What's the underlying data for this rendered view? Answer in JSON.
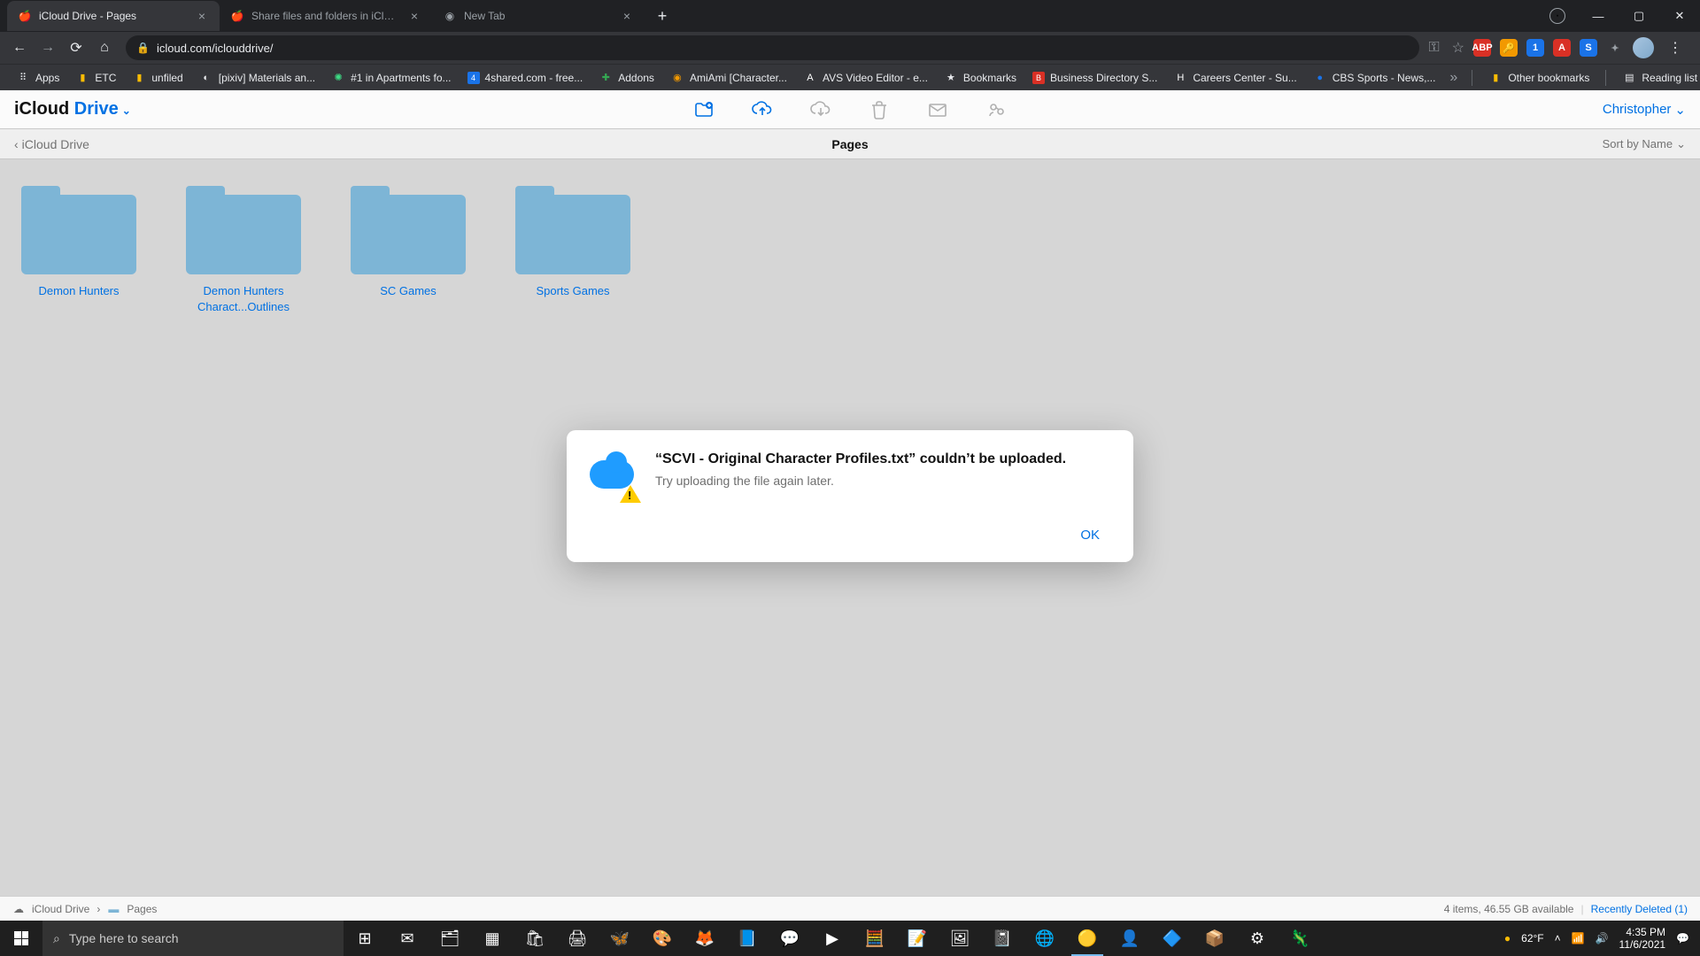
{
  "browser": {
    "tabs": [
      {
        "title": "iCloud Drive - Pages",
        "active": true
      },
      {
        "title": "Share files and folders in iCloud D",
        "active": false
      },
      {
        "title": "New Tab",
        "active": false
      }
    ],
    "url": "icloud.com/iclouddrive/",
    "bookmarks": [
      {
        "label": "Apps"
      },
      {
        "label": "ETC"
      },
      {
        "label": "unfiled"
      },
      {
        "label": "[pixiv] Materials an..."
      },
      {
        "label": "#1 in Apartments fo..."
      },
      {
        "label": "4shared.com - free..."
      },
      {
        "label": "Addons"
      },
      {
        "label": "AmiAmi [Character..."
      },
      {
        "label": "AVS Video Editor - e..."
      },
      {
        "label": "Bookmarks"
      },
      {
        "label": "Business Directory S..."
      },
      {
        "label": "Careers Center - Su..."
      },
      {
        "label": "CBS Sports - News,..."
      }
    ],
    "other_bookmarks": "Other bookmarks",
    "reading_list": "Reading list"
  },
  "icloud": {
    "brand_a": "iCloud ",
    "brand_b": "Drive",
    "user": "Christopher",
    "back_label": "iCloud Drive",
    "location": "Pages",
    "sort_label": "Sort by Name",
    "folders": [
      {
        "name": "Demon Hunters"
      },
      {
        "name": "Demon Hunters Charact...Outlines"
      },
      {
        "name": "SC Games"
      },
      {
        "name": "Sports Games"
      }
    ],
    "breadcrumb": [
      {
        "label": "iCloud Drive"
      },
      {
        "label": "Pages"
      }
    ],
    "status_items": "4 items, 46.55 GB available",
    "recently_deleted": "Recently Deleted (1)"
  },
  "dialog": {
    "title": "“SCVI - Original Character Profiles.txt” couldn’t be uploaded.",
    "subtitle": "Try uploading the file again later.",
    "ok": "OK"
  },
  "taskbar": {
    "search_placeholder": "Type here to search",
    "weather": "62°F",
    "time": "4:35 PM",
    "date": "11/6/2021"
  }
}
